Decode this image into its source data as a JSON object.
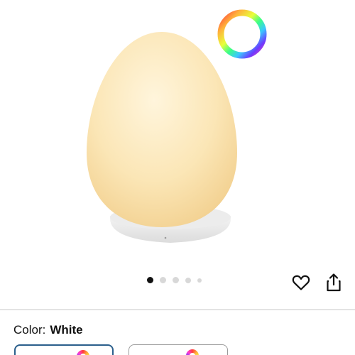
{
  "product": {
    "image_icon": "egg-night-lamp-image",
    "accent_ring_icon": "rgb-color-ring-icon"
  },
  "carousel": {
    "total_images": 5,
    "active_index": 0
  },
  "actions": {
    "favorite_icon": "heart-icon",
    "share_icon": "share-icon"
  },
  "variant": {
    "label": "Color:",
    "value": "White",
    "options_visible": 2,
    "selected_index": 0,
    "selected_border_color": "#2b5f8c"
  }
}
